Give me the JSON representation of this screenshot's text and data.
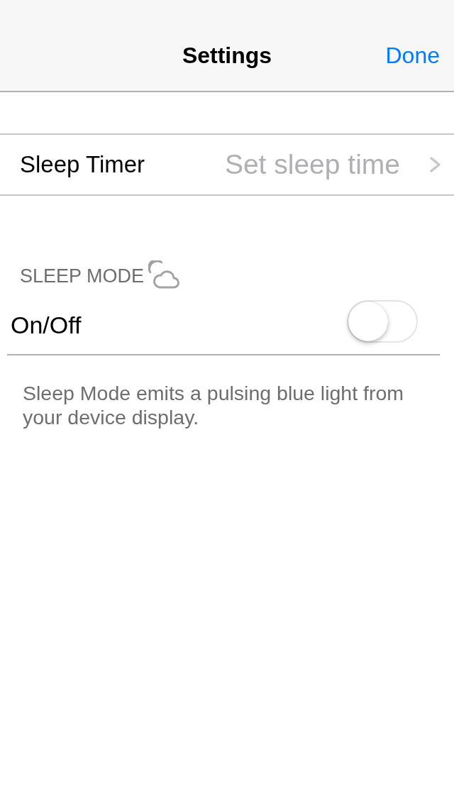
{
  "nav_bar": {
    "title": "Settings",
    "done_button": "Done"
  },
  "timer_row": {
    "label": "Sleep Timer",
    "value": "Set sleep time"
  },
  "sleep_mode": {
    "header": "SLEEP MODE",
    "toggle": {
      "label": "On/Off",
      "on": false
    },
    "footer": "Sleep Mode emits a pulsing blue light from your device display."
  }
}
